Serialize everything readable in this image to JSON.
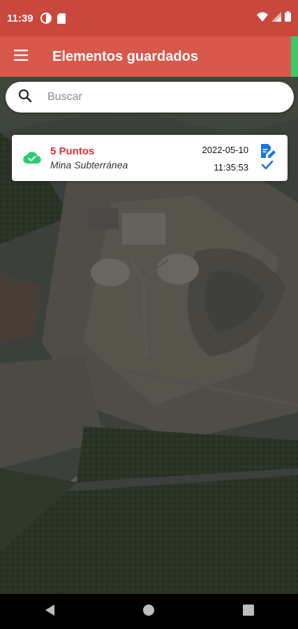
{
  "status_bar": {
    "time": "11:39"
  },
  "app_bar": {
    "title": "Elementos guardados",
    "menu_icon": "hamburger-menu-icon",
    "bg": "#d8584b"
  },
  "search": {
    "placeholder": "Buscar",
    "value": "",
    "icon": "search-icon"
  },
  "saved_items": [
    {
      "title": "5 Puntos",
      "subtitle": "Mina Subterránea",
      "date": "2022-05-10",
      "time": "11:35:53",
      "sync_icon": "cloud-check-icon",
      "edit_icon": "edit-document-icon",
      "select_icon": "check-icon"
    }
  ],
  "nav": {
    "back": "back-icon",
    "home": "home-icon",
    "recents": "recents-icon"
  },
  "colors": {
    "accent_red": "#e53030",
    "icon_blue": "#1a73e8",
    "sync_green": "#2ecc71"
  }
}
